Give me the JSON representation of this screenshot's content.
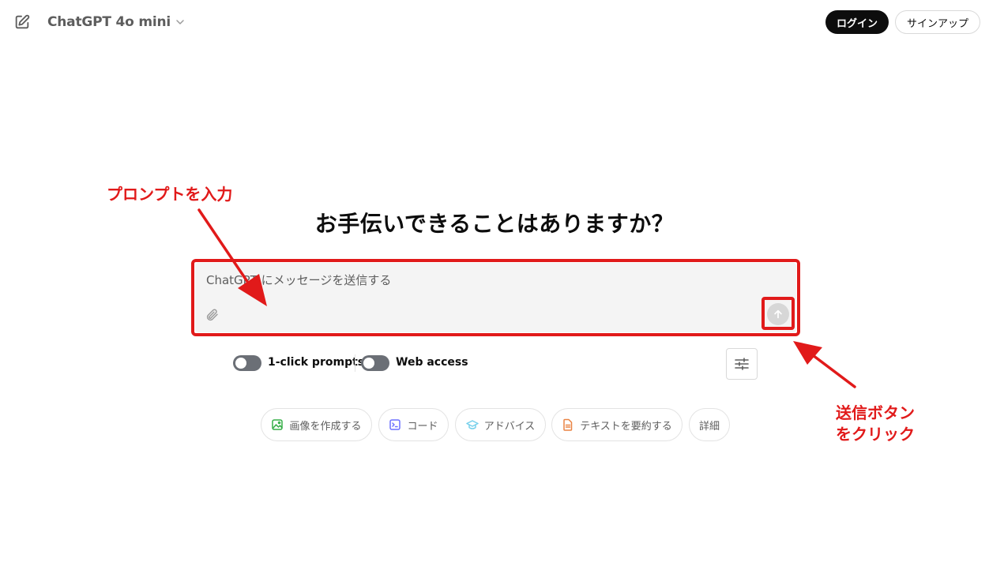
{
  "header": {
    "model_name": "ChatGPT 4o mini",
    "login_label": "ログイン",
    "signup_label": "サインアップ"
  },
  "main": {
    "heading": "お手伝いできることはありますか？",
    "composer": {
      "placeholder": "ChatGPT にメッセージを送信する",
      "value": ""
    },
    "toggles": [
      {
        "label": "1-click prompts",
        "on": false
      },
      {
        "label": "Web access",
        "on": false
      }
    ],
    "suggestions": [
      {
        "label": "画像を作成する",
        "icon": "image-icon",
        "color": "#35ae47"
      },
      {
        "label": "コード",
        "icon": "terminal-icon",
        "color": "#6c71ff"
      },
      {
        "label": "アドバイス",
        "icon": "graduation-cap-icon",
        "color": "#76d0eb"
      },
      {
        "label": "テキストを要約する",
        "icon": "document-icon",
        "color": "#ea8444"
      },
      {
        "label": "詳細"
      }
    ]
  },
  "annotations": {
    "prompt_note": "プロンプトを入力",
    "send_note_line1": "送信ボタン",
    "send_note_line2": "をクリック",
    "color": "#e11a1a"
  }
}
